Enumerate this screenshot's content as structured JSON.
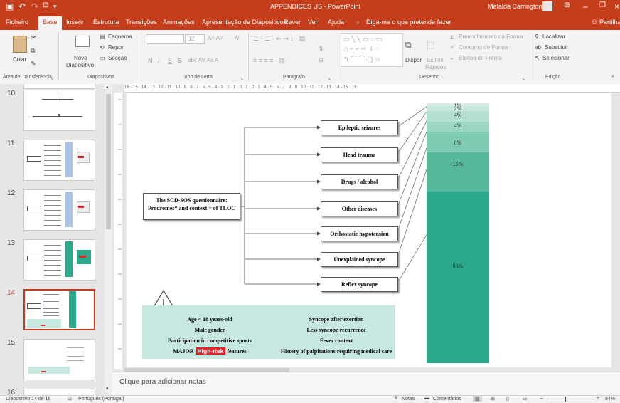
{
  "title_bar": {
    "doc_title": "APPENDICES US - PowerPoint",
    "user_name": "Mafalda Carrington"
  },
  "tabs": [
    "Ficheiro",
    "Base",
    "Inserir",
    "Estrutura",
    "Transições",
    "Animações",
    "Apresentação de Diapositivos",
    "Rever",
    "Ver",
    "Ajuda"
  ],
  "active_tab": "Base",
  "tell_me": "Diga-me o que pretende fazer",
  "share": "Partilhar",
  "ribbon": {
    "clipboard": {
      "paste": "Colar",
      "label": "Área de Transferência"
    },
    "slides": {
      "new_slide_1": "Novo",
      "new_slide_2": "Diapositivo",
      "layout": "Esquema",
      "reset": "Repor",
      "section": "Secção",
      "label": "Diapositivos"
    },
    "font": {
      "size": "12",
      "bold": "N",
      "italic": "I",
      "underline": "S",
      "strike": "S",
      "label": "Tipo de Letra"
    },
    "paragraph": {
      "label": "Paragrafo"
    },
    "drawing": {
      "arrange": "Dispor",
      "quick_styles_1": "Estilos",
      "quick_styles_2": "Rápidos",
      "fill": "Preenchimento da Forma",
      "outline": "Contorno de Forma",
      "effects": "Efeitos de Forma",
      "label": "Desenho"
    },
    "editing": {
      "find": "Localizar",
      "replace": "Substituir",
      "select": "Selecionar",
      "label": "Edição"
    }
  },
  "thumbnails": [
    "10",
    "11",
    "12",
    "13",
    "14",
    "15",
    "16"
  ],
  "selected_slide": "14",
  "ruler_marks": "16 · 15 · 14 · 13 · 12 · 11 · 10 · 9 · 8 · 7 · 6 · 5 · 4 · 3 · 2 · 1 · 0 · 1 · 2 · 3 · 4 · 5 · 6 · 7 · 8 · 9 · 10 · 11 · 12 · 13 · 14 · 15 · 16",
  "slide": {
    "main_box": "The SCD-SOS questionnaire: Prodromes* and context + of TLOC",
    "causes": [
      "Epileptic seizures",
      "Head trauma",
      "Drugs / alcohol",
      "Other diseases",
      "Orthostatic hypotension",
      "Unexplained syncope",
      "Reflex syncope"
    ],
    "bar_segments": [
      "1%",
      "2%",
      "4%",
      "4%",
      "8%",
      "15%",
      "66%"
    ],
    "bar_colors": [
      "#d8efe9",
      "#c8e8df",
      "#b3e0d3",
      "#9bd6c4",
      "#7fcab3",
      "#57b99c",
      "#2ca98a"
    ],
    "bar_shares": [
      1,
      2,
      4,
      4,
      8,
      15,
      66
    ],
    "warning_left": [
      "Age < 18 years-old",
      "Male gender",
      "Participation in competitive sports"
    ],
    "warning_right": [
      "Syncope after exertion",
      "Less syncope recurrence",
      "Fever context",
      "History of palpitations requiring medical care"
    ],
    "major_pre": "MAJOR",
    "high_risk": "High-risk",
    "major_post": "features",
    "warning_bg": "#c6e8e0",
    "high_risk_color": "#e0242a"
  },
  "notes_placeholder": "Clique para adicionar notas",
  "status": {
    "slide_info": "Diapositivo 14 de 16",
    "language": "Português (Portugal)",
    "notes": "Notas",
    "comments": "Comentários",
    "zoom": "84%"
  },
  "theme": {
    "accent": "#c43e1c"
  }
}
